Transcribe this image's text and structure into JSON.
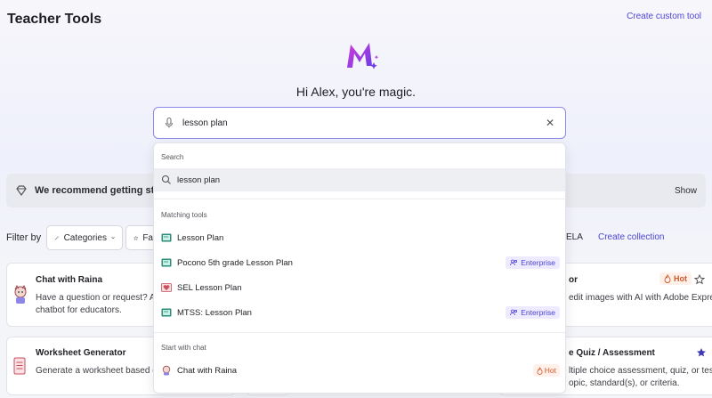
{
  "header": {
    "title": "Teacher Tools",
    "create_custom_tool": "Create custom tool"
  },
  "hero": {
    "greeting": "Hi Alex, you're magic."
  },
  "search": {
    "value": "lesson plan",
    "placeholder": ""
  },
  "banner": {
    "text": "We recommend getting starte",
    "show": "Show"
  },
  "filters": {
    "label": "Filter by",
    "categories": "Categories",
    "favorites_partial": "Fa",
    "ela_partial": "ELA",
    "create_collection": "Create collection"
  },
  "cards": {
    "chat_raina": {
      "title": "Chat with Raina",
      "desc_line1": "Have a question or request? Ask",
      "desc_line2": "chatbot for educators."
    },
    "worksheet": {
      "title": "Worksheet Generator",
      "desc_line1": "Generate a worksheet based on a"
    },
    "right_top": {
      "title_partial": "or",
      "hot": "Hot",
      "desc_line1": "edit images with AI with Adobe Express."
    },
    "right_bottom": {
      "title_partial": "e Quiz / Assessment",
      "desc_line1": "ltiple choice assessment, quiz, or test",
      "desc_line2": "opic, standard(s), or criteria."
    }
  },
  "dropdown": {
    "search_section": "Search",
    "search_item": "lesson plan",
    "matching_section": "Matching tools",
    "tools": [
      {
        "label": "Lesson Plan",
        "badge": ""
      },
      {
        "label": "Pocono 5th grade Lesson Plan",
        "badge": "Enterprise"
      },
      {
        "label": "SEL Lesson Plan",
        "badge": ""
      },
      {
        "label": "MTSS: Lesson Plan",
        "badge": "Enterprise"
      }
    ],
    "chat_section": "Start with chat",
    "chat_item": "Chat with Raina",
    "chat_badge": "Hot"
  },
  "colors": {
    "accent": "#4c46d6",
    "hot": "#d05a2a",
    "enterprise_bg": "#eeeaff"
  }
}
